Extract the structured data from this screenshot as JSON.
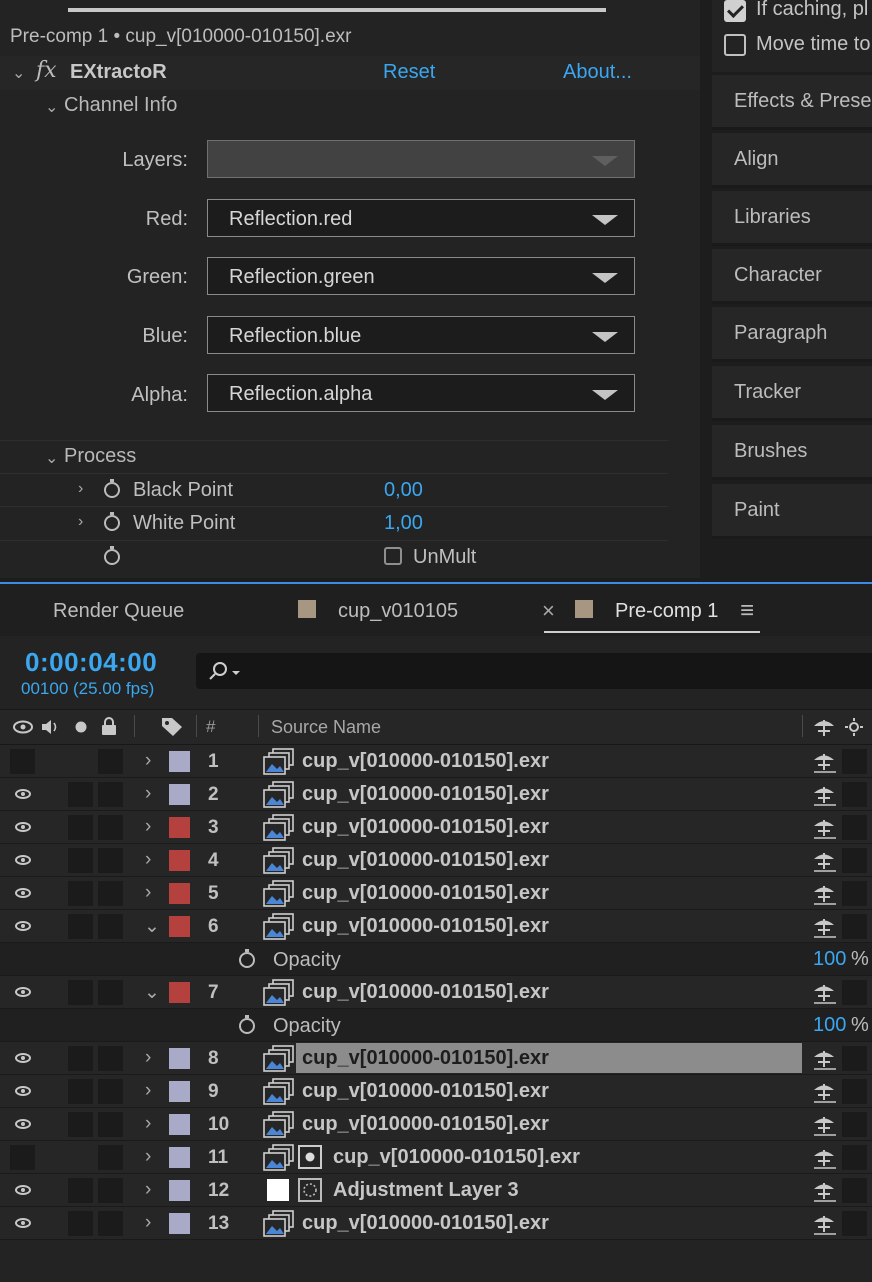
{
  "effect_controls": {
    "title": "Pre-comp 1 • cup_v[010000-010150].exr",
    "fx_symbol": "fx",
    "effect_name": "EXtractoR",
    "reset_label": "Reset",
    "about_label": "About...",
    "channel_info": {
      "label": "Channel Info",
      "rows": [
        {
          "label": "Layers:",
          "value": ""
        },
        {
          "label": "Red:",
          "value": "Reflection.red"
        },
        {
          "label": "Green:",
          "value": "Reflection.green"
        },
        {
          "label": "Blue:",
          "value": "Reflection.blue"
        },
        {
          "label": "Alpha:",
          "value": "Reflection.alpha"
        }
      ]
    },
    "process": {
      "label": "Process",
      "black_point": {
        "label": "Black Point",
        "value": "0,00"
      },
      "white_point": {
        "label": "White Point",
        "value": "1,00"
      },
      "unmult": {
        "label": "UnMult",
        "checked": false
      }
    }
  },
  "right_panel": {
    "if_caching": {
      "label": "If caching, pl",
      "checked": true
    },
    "move_time": {
      "label": "Move time to",
      "checked": false
    },
    "items": [
      "Effects & Prese",
      "Align",
      "Libraries",
      "Character",
      "Paragraph",
      "Tracker",
      "Brushes",
      "Paint"
    ]
  },
  "timeline": {
    "tabs": [
      {
        "label": "Render Queue"
      },
      {
        "label": "cup_v010105",
        "color": "#a69682"
      },
      {
        "label": "Pre-comp 1",
        "color": "#a69682",
        "active": true
      }
    ],
    "close_glyph": "×",
    "menu_glyph": "≡",
    "timecode": "0:00:04:00",
    "frame_info": "00100 (25.00 fps)",
    "header": {
      "num": "#",
      "source_name": "Source Name"
    },
    "layers": [
      {
        "num": "1",
        "name": "cup_v[010000-010150].exr",
        "color": "#a9a9c8",
        "visible": false,
        "expanded": false,
        "type": "seq"
      },
      {
        "num": "2",
        "name": "cup_v[010000-010150].exr",
        "color": "#a9a9c8",
        "visible": true,
        "expanded": false,
        "type": "seq"
      },
      {
        "num": "3",
        "name": "cup_v[010000-010150].exr",
        "color": "#b5413e",
        "visible": true,
        "expanded": false,
        "type": "seq"
      },
      {
        "num": "4",
        "name": "cup_v[010000-010150].exr",
        "color": "#b5413e",
        "visible": true,
        "expanded": false,
        "type": "seq"
      },
      {
        "num": "5",
        "name": "cup_v[010000-010150].exr",
        "color": "#b5413e",
        "visible": true,
        "expanded": false,
        "type": "seq"
      },
      {
        "num": "6",
        "name": "cup_v[010000-010150].exr",
        "color": "#b5413e",
        "visible": true,
        "expanded": true,
        "type": "seq",
        "opacity": {
          "label": "Opacity",
          "value": "100",
          "unit": "%"
        }
      },
      {
        "num": "7",
        "name": "cup_v[010000-010150].exr",
        "color": "#b5413e",
        "visible": true,
        "expanded": true,
        "type": "seq",
        "opacity": {
          "label": "Opacity",
          "value": "100",
          "unit": "%"
        }
      },
      {
        "num": "8",
        "name": "cup_v[010000-010150].exr",
        "color": "#a9a9c8",
        "visible": true,
        "expanded": false,
        "type": "seq",
        "selected": true
      },
      {
        "num": "9",
        "name": "cup_v[010000-010150].exr",
        "color": "#a9a9c8",
        "visible": true,
        "expanded": false,
        "type": "seq"
      },
      {
        "num": "10",
        "name": "cup_v[010000-010150].exr",
        "color": "#a9a9c8",
        "visible": true,
        "expanded": false,
        "type": "seq"
      },
      {
        "num": "11",
        "name": "cup_v[010000-010150].exr",
        "color": "#a9a9c8",
        "visible": false,
        "expanded": false,
        "type": "seq-matte"
      },
      {
        "num": "12",
        "name": "Adjustment Layer 3",
        "color": "#a9a9c8",
        "visible": true,
        "expanded": false,
        "type": "adjustment"
      },
      {
        "num": "13",
        "name": "cup_v[010000-010150].exr",
        "color": "#a9a9c8",
        "visible": true,
        "expanded": false,
        "type": "seq"
      }
    ]
  }
}
